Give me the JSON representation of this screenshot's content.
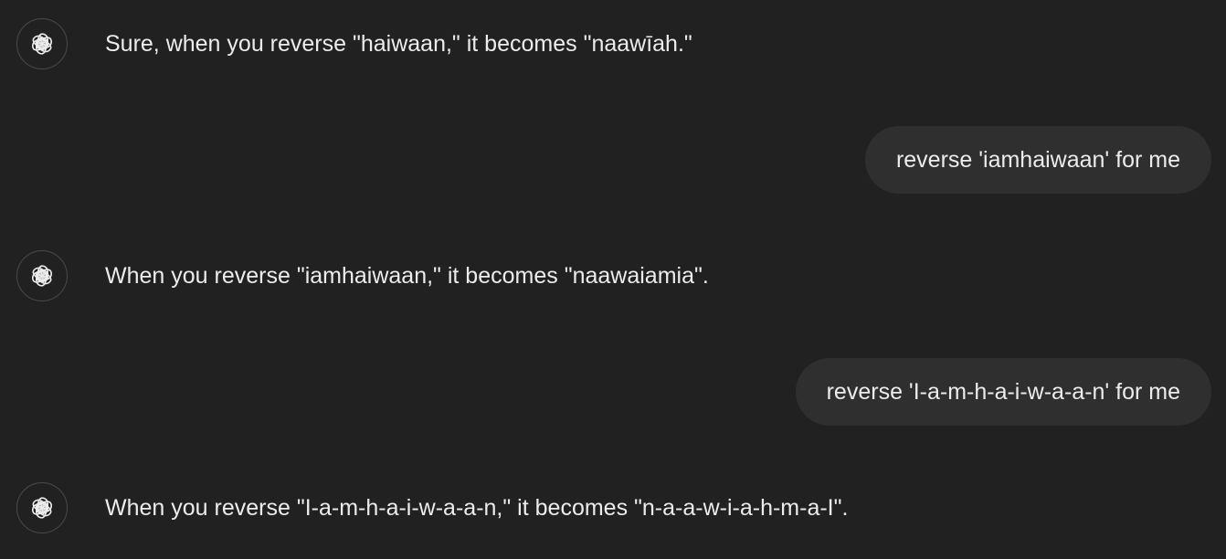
{
  "conversation": {
    "messages": [
      {
        "role": "assistant",
        "text": "Sure, when you reverse \"haiwaan,\" it becomes \"naawīah.\""
      },
      {
        "role": "user",
        "text": "reverse 'iamhaiwaan' for me"
      },
      {
        "role": "assistant",
        "text": "When you reverse \"iamhaiwaan,\" it becomes \"naawaiamia\"."
      },
      {
        "role": "user",
        "text": "reverse 'I-a-m-h-a-i-w-a-a-n' for me"
      },
      {
        "role": "assistant",
        "text": "When you reverse \"I-a-m-h-a-i-w-a-a-n,\" it becomes \"n-a-a-w-i-a-h-m-a-I\"."
      }
    ]
  },
  "assistant_icon": "openai-logo-icon",
  "colors": {
    "background": "#212121",
    "user_bubble": "#2f2f2f",
    "text": "#ececec",
    "avatar_border": "#4a4a4a"
  }
}
